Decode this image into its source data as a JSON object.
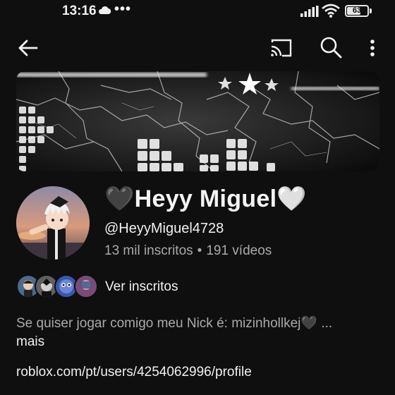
{
  "status_bar": {
    "time": "13:16",
    "dots": "•••",
    "battery": "63",
    "battery_level": 0.63,
    "icons": [
      "cloud-icon",
      "signal-icon",
      "wifi-icon",
      "battery-icon"
    ]
  },
  "app_bar": {
    "icons": [
      "back-arrow-icon",
      "cast-icon",
      "search-icon",
      "more-vert-icon"
    ]
  },
  "channel": {
    "name": "🖤Heyy Miguel🤍",
    "handle": "@HeyyMiguel4728",
    "subscribers": "13 mil inscritos",
    "separator": "•",
    "videos": "191 vídeos"
  },
  "subscribers_row": {
    "label": "Ver inscritos"
  },
  "description": {
    "text": "Se quiser jogar comigo meu Nick é: mizinhollkej🖤 ...",
    "more": "mais"
  },
  "link": "roblox.com/pt/users/4254062996/profile",
  "colors": {
    "background": "#0f0f0f",
    "primary_text": "#f1f1f1",
    "secondary_text": "#aaaaaa"
  }
}
